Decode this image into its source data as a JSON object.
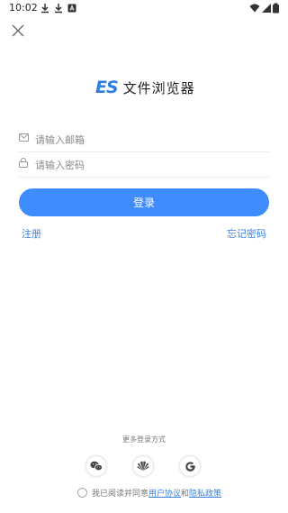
{
  "status_bar": {
    "time": "10:02"
  },
  "logo": {
    "mark": "ES",
    "app_name": "文件浏览器"
  },
  "email": {
    "placeholder": "请输入邮箱",
    "value": ""
  },
  "password": {
    "placeholder": "请输入密码",
    "value": ""
  },
  "login_label": "登录",
  "register_label": "注册",
  "forgot_label": "忘记密码",
  "more_login_label": "更多登录方式",
  "social_icons": [
    "wechat-icon",
    "huawei-icon",
    "google-icon"
  ],
  "agreement": {
    "prefix": "我已阅读并同意",
    "user_agreement": "用户协议",
    "and": "和",
    "privacy_policy": "隐私政策"
  },
  "colors": {
    "accent": "#3f8cff",
    "link": "#3b82e6",
    "logo": "#2f7de1"
  }
}
